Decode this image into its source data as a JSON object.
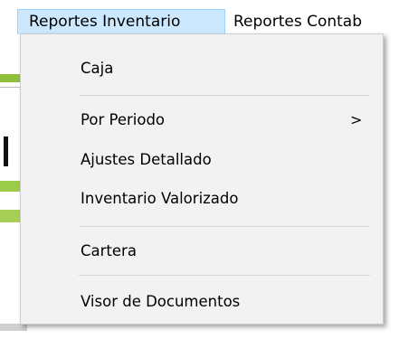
{
  "menubar": {
    "items": [
      {
        "label": "Reportes Inventario"
      },
      {
        "label": "Reportes Contab"
      }
    ]
  },
  "dropdown": {
    "items": [
      {
        "label": "Caja"
      },
      {
        "label": "Por Periodo",
        "submenu_icon": "chevron-right-icon",
        "arrow": ">"
      },
      {
        "label": "Ajustes Detallado"
      },
      {
        "label": "Inventario Valorizado"
      },
      {
        "label": "Cartera"
      },
      {
        "label": "Visor de Documentos"
      }
    ]
  },
  "colors": {
    "menubar_active_bg": "#cce8ff",
    "menubar_active_border": "#99d1ff",
    "dropdown_bg": "#f2f2f2",
    "separator": "#d7d7d7"
  }
}
